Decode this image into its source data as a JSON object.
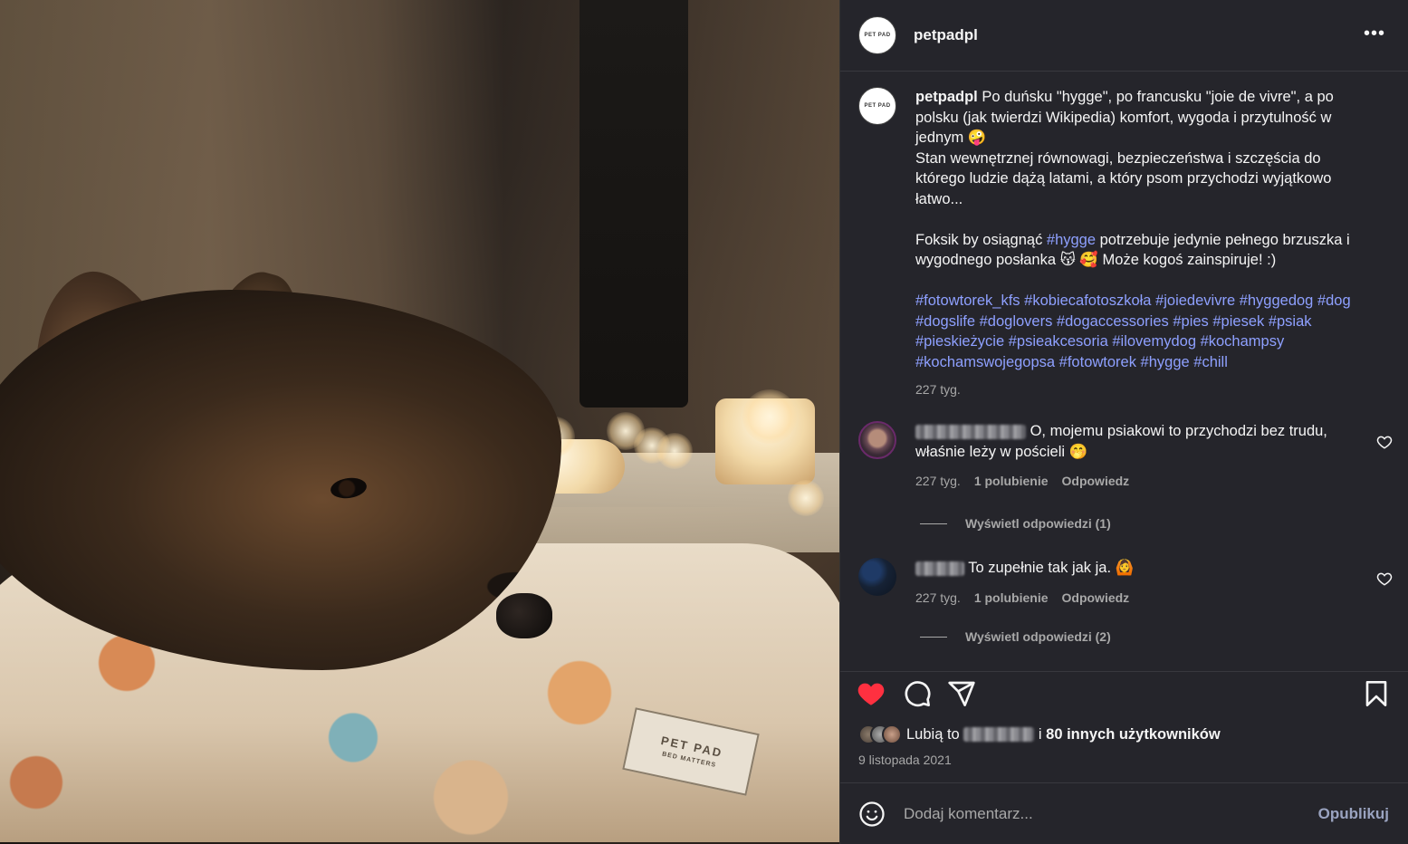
{
  "post": {
    "username": "petpadpl",
    "avatar_logo_text": "PET PAD",
    "more_label": "•••",
    "photo_label": {
      "brand": "PET PAD",
      "tagline": "BED MATTERS"
    },
    "caption": {
      "username": "petpadpl",
      "line1": " Po duńsku \"hygge\", po francusku \"joie de vivre\", a po polsku (jak twierdzi Wikipedia) komfort, wygoda i przytulność w jednym 🤪",
      "line2": "Stan wewnętrznej równowagi, bezpieczeństwa i szczęścia do którego ludzie dążą latami, a który psom przychodzi wyjątkowo łatwo...",
      "line3_before": "Foksik by osiągnąć ",
      "line3_tag": "#hygge",
      "line3_after": " potrzebuje jedynie pełnego brzuszka i wygodnego posłanka 😽 🥰 Może kogoś zainspiruje! :)",
      "hashtags": "#fotowtorek_kfs #kobiecafotoszkoła #joiedevivre #hyggedog #dog #dogslife #doglovers #dogaccessories #pies #piesek #psiak #pieskieżycie #psieakcesoria #ilovemydog #kochampsy #kochamswojegopsa #fotowtorek #hygge #chill",
      "time": "227 tyg."
    },
    "comments": [
      {
        "text": " O, mojemu psiakowi to przychodzi bez trudu, właśnie leży w pościeli 🤭",
        "time": "227 tyg.",
        "likes": "1 polubienie",
        "reply": "Odpowiedz",
        "view_replies": "Wyświetl odpowiedzi (1)"
      },
      {
        "text": " To zupełnie tak jak ja. 🙆",
        "time": "227 tyg.",
        "likes": "1 polubienie",
        "reply": "Odpowiedz",
        "view_replies": "Wyświetl odpowiedzi (2)"
      }
    ],
    "likes": {
      "prefix": "Lubią to ",
      "suffix": " i ",
      "others": "80 innych użytkowników"
    },
    "date": "9 listopada 2021",
    "add_comment": {
      "placeholder": "Dodaj komentarz...",
      "publish": "Opublikuj"
    },
    "icons": {
      "like": "heart-filled-icon",
      "comment": "comment-icon",
      "share": "send-icon",
      "save": "bookmark-icon",
      "emoji": "smiley-icon"
    },
    "colors": {
      "panel_bg": "#25252b",
      "hashtag": "#8ea0ff",
      "like_red": "#ff3040",
      "muted": "#a8a8a8"
    }
  }
}
